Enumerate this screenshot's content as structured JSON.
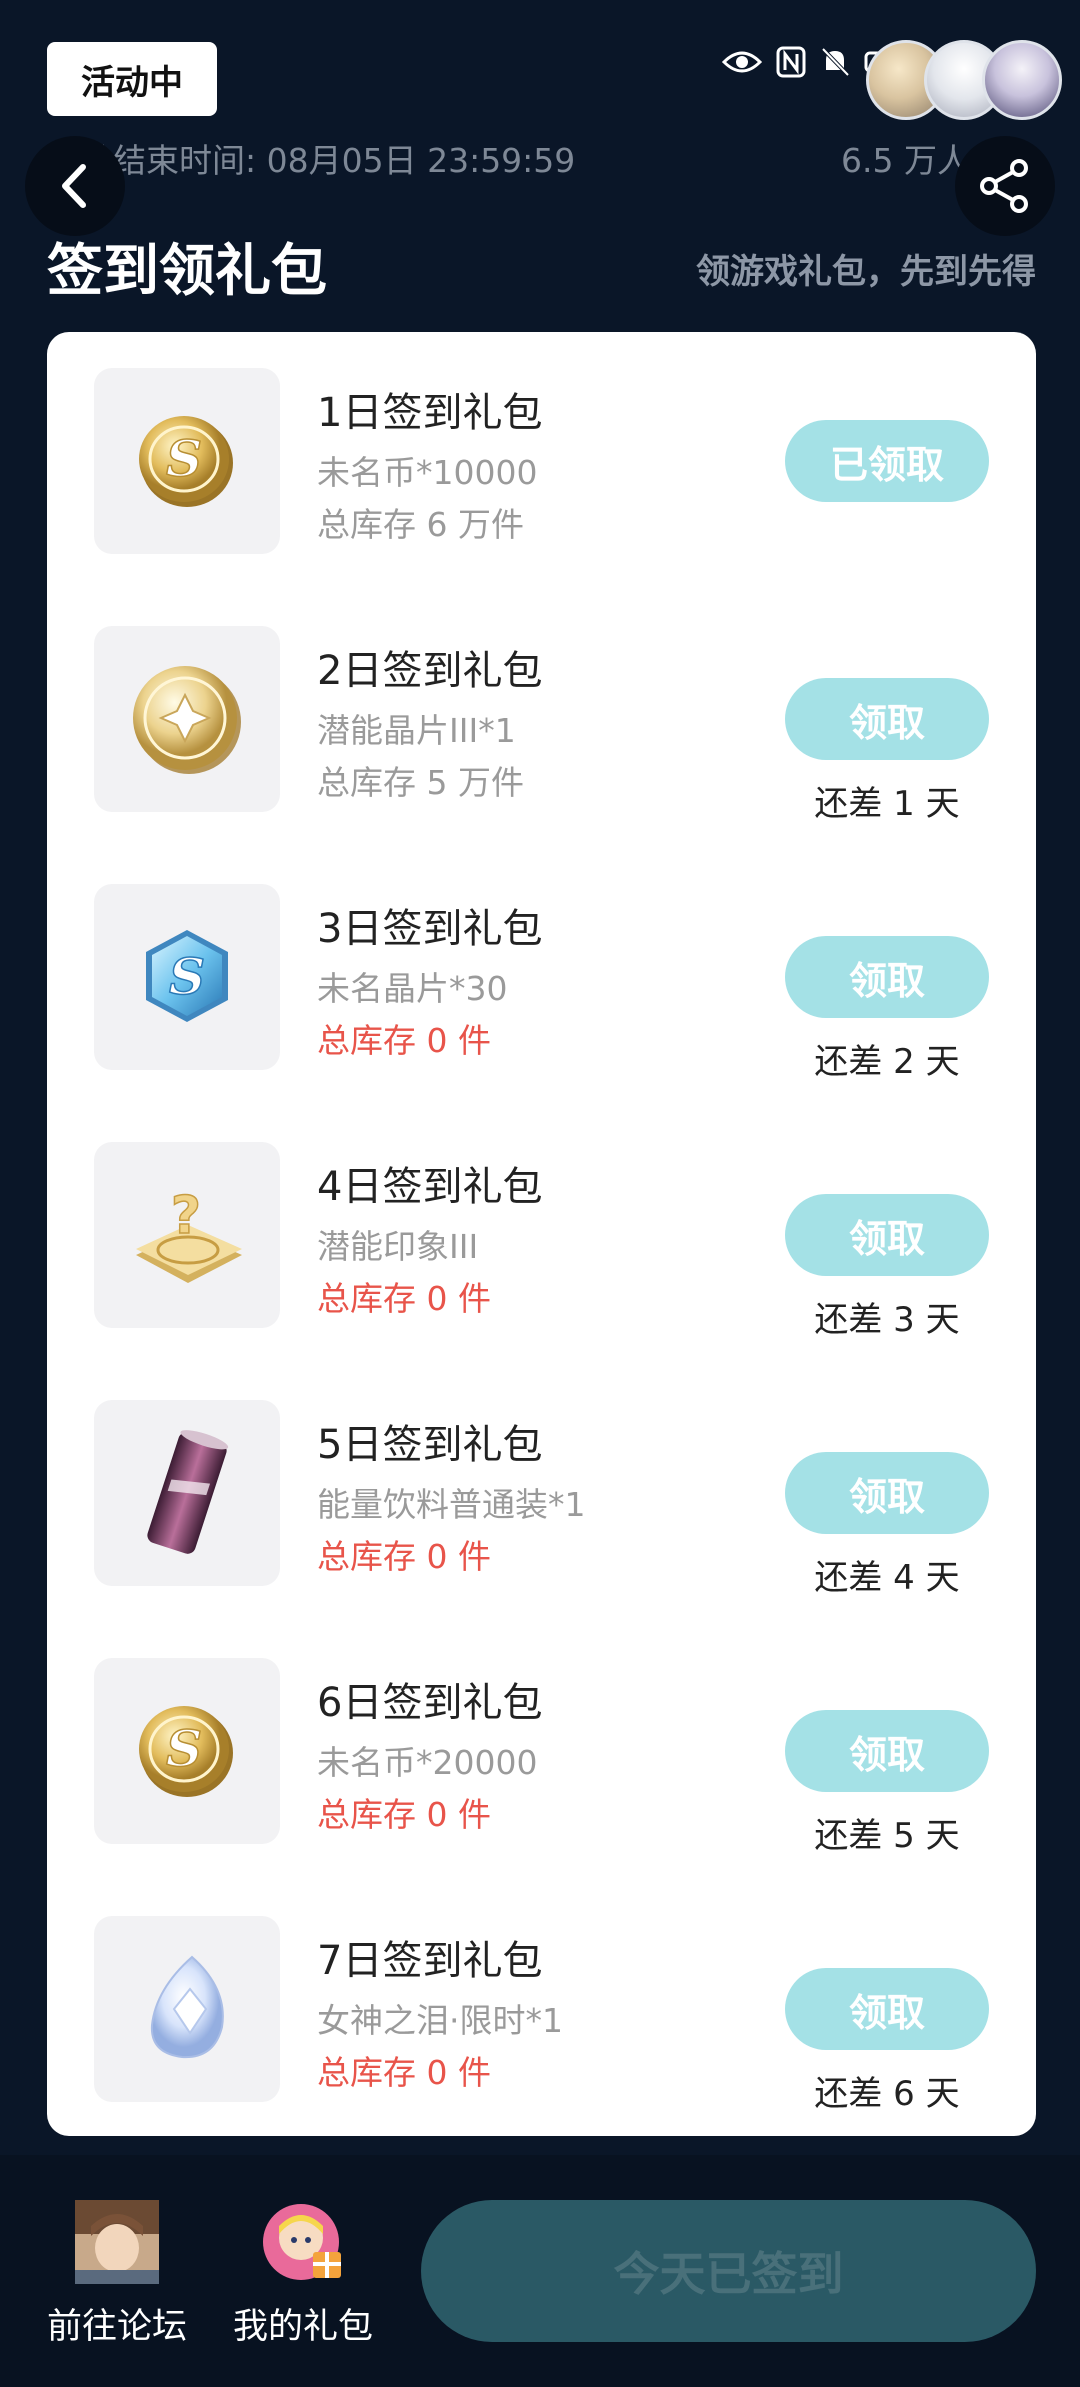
{
  "header": {
    "badge": "活动中",
    "end_time": "活动结束时间: 08月05日 23:59:59",
    "participants": "6.5 万人参加",
    "title": "签到领礼包",
    "subtitle": "领游戏礼包，先到先得"
  },
  "rows": [
    {
      "title": "1日签到礼包",
      "item": "未名币*10000",
      "stock": "总库存 6 万件",
      "button": "已领取",
      "remain": "",
      "icon": "gold-coin-icon"
    },
    {
      "title": "2日签到礼包",
      "item": "潜能晶片III*1",
      "stock": "总库存 5 万件",
      "button": "领取",
      "remain": "还差 1 天",
      "icon": "potential-chip-icon"
    },
    {
      "title": "3日签到礼包",
      "item": "未名晶片*30",
      "stock": "总库存 0 件",
      "button": "领取",
      "remain": "还差 2 天",
      "icon": "blue-crystal-icon"
    },
    {
      "title": "4日签到礼包",
      "item": "潜能印象III",
      "stock": "总库存 0 件",
      "button": "领取",
      "remain": "还差 3 天",
      "icon": "mystery-plate-icon"
    },
    {
      "title": "5日签到礼包",
      "item": "能量饮料普通装*1",
      "stock": "总库存 0 件",
      "button": "领取",
      "remain": "还差 4 天",
      "icon": "energy-drink-icon"
    },
    {
      "title": "6日签到礼包",
      "item": "未名币*20000",
      "stock": "总库存 0 件",
      "button": "领取",
      "remain": "还差 5 天",
      "icon": "gold-coin-icon"
    },
    {
      "title": "7日签到礼包",
      "item": "女神之泪·限时*1",
      "stock": "总库存 0 件",
      "button": "领取",
      "remain": "还差 6 天",
      "icon": "tear-gem-icon"
    }
  ],
  "bottom": {
    "forum_label": "前往论坛",
    "gifts_label": "我的礼包",
    "signed_label": "今天已签到"
  },
  "colors": {
    "background": "#0a1628",
    "claim_button": "#a4e1e6",
    "stock_empty": "#e8544a",
    "signed_button": "#2a5965"
  }
}
